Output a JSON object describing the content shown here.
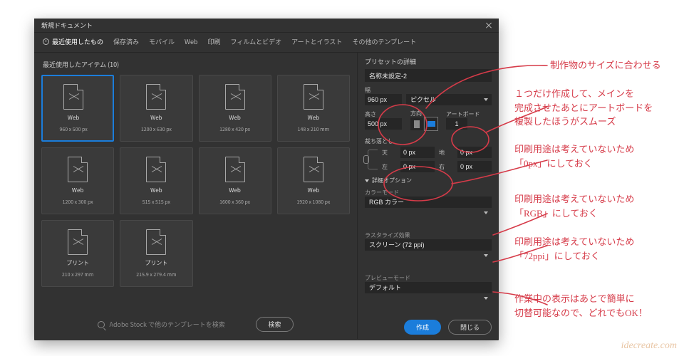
{
  "title": "新規ドキュメント",
  "tabs": {
    "recent": "最近使用したもの",
    "saved": "保存済み",
    "mobile": "モバイル",
    "web": "Web",
    "print": "印刷",
    "film": "フィルムとビデオ",
    "art": "アートとイラスト",
    "other": "その他のテンプレート"
  },
  "recent_header": "最近使用したアイテム (10)",
  "cards": [
    {
      "label": "Web",
      "dim": "960 x 500 px"
    },
    {
      "label": "Web",
      "dim": "1200 x 630 px"
    },
    {
      "label": "Web",
      "dim": "1280 x 420 px"
    },
    {
      "label": "Web",
      "dim": "148 x 210 mm"
    },
    {
      "label": "Web",
      "dim": "1200 x 300 px"
    },
    {
      "label": "Web",
      "dim": "515 x 515 px"
    },
    {
      "label": "Web",
      "dim": "1600 x 360 px"
    },
    {
      "label": "Web",
      "dim": "1920 x 1080 px"
    },
    {
      "label": "プリント",
      "dim": "210 x 297 mm"
    },
    {
      "label": "プリント",
      "dim": "215.9 x 279.4 mm"
    }
  ],
  "search": {
    "placeholder": "Adobe Stock で他のテンプレートを検索",
    "button": "検索"
  },
  "panel": {
    "header": "プリセットの詳細",
    "name": "名称未設定-2",
    "width_label": "幅",
    "width": "960 px",
    "units": "ピクセル",
    "height_label": "高さ",
    "height": "500 px",
    "orient_label": "方向",
    "artboard_label": "アートボード",
    "artboards": "1",
    "bleed_label": "裁ち落とし",
    "bleed_top": "天",
    "bleed_bottom": "地",
    "bleed_left": "左",
    "bleed_right": "右",
    "bleed_val": "0 px",
    "advanced": "詳細オプション",
    "colormode_label": "カラーモード",
    "colormode": "RGB カラー",
    "raster_label": "ラスタライズ効果",
    "raster": "スクリーン (72 ppi)",
    "preview_label": "プレビューモード",
    "preview": "デフォルト",
    "create": "作成",
    "cancel": "閉じる"
  },
  "notes": {
    "n1": "制作物のサイズに合わせる",
    "n2": "１つだけ作成して、メインを\n完成させたあとにアートボードを\n複製したほうがスムーズ",
    "n3": "印刷用途は考えていないため\n「0px」にしておく",
    "n4": "印刷用途は考えていないため\n「RGB」にしておく",
    "n5": "印刷用途は考えていないため\n「72ppi」にしておく",
    "n6": "作業中の表示はあとで簡単に\n切替可能なので、どれでもOK！"
  },
  "credit": "idecreate.com"
}
